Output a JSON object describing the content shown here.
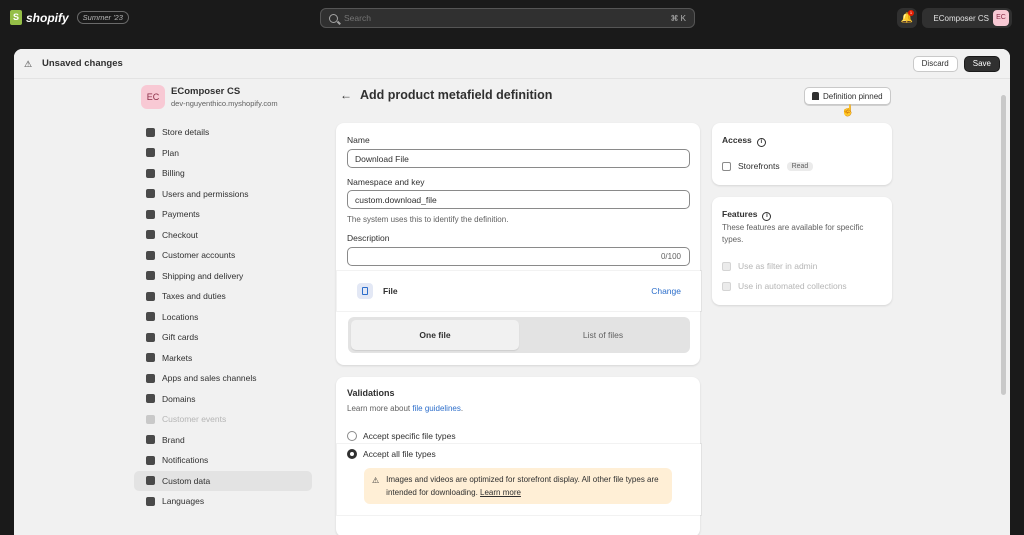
{
  "topbar": {
    "logo_text": "shopify",
    "edition": "Summer '23",
    "search_placeholder": "Search",
    "search_shortcut": "⌘ K",
    "store_name": "EComposer CS",
    "avatar_initials": "EC",
    "notification_count": "1"
  },
  "modal": {
    "title": "Unsaved changes",
    "discard_label": "Discard",
    "save_label": "Save"
  },
  "store": {
    "initials": "EC",
    "name": "EComposer CS",
    "domain": "dev-nguyenthico.myshopify.com"
  },
  "sidebar": {
    "items": [
      {
        "label": "Store details"
      },
      {
        "label": "Plan"
      },
      {
        "label": "Billing"
      },
      {
        "label": "Users and permissions"
      },
      {
        "label": "Payments"
      },
      {
        "label": "Checkout"
      },
      {
        "label": "Customer accounts"
      },
      {
        "label": "Shipping and delivery"
      },
      {
        "label": "Taxes and duties"
      },
      {
        "label": "Locations"
      },
      {
        "label": "Gift cards"
      },
      {
        "label": "Markets"
      },
      {
        "label": "Apps and sales channels"
      },
      {
        "label": "Domains"
      },
      {
        "label": "Customer events"
      },
      {
        "label": "Brand"
      },
      {
        "label": "Notifications"
      },
      {
        "label": "Custom data"
      },
      {
        "label": "Languages"
      }
    ],
    "active": "Custom data",
    "disabled": "Customer events"
  },
  "page": {
    "title": "Add product metafield definition",
    "pinned_label": "Definition pinned"
  },
  "form": {
    "name_label": "Name",
    "name_value": "Download File",
    "namespace_label": "Namespace and key",
    "namespace_value": "custom.download_file",
    "namespace_help": "The system uses this to identify the definition.",
    "description_label": "Description",
    "description_value": "",
    "description_counter": "0/100",
    "type_label": "File",
    "change_label": "Change",
    "seg_one": "One file",
    "seg_list": "List of files"
  },
  "validations": {
    "title": "Validations",
    "help_prefix": "Learn more about ",
    "help_link": "file guidelines",
    "help_suffix": ".",
    "option_specific": "Accept specific file types",
    "option_all": "Accept all file types",
    "banner_text": "Images and videos are optimized for storefront display. All other file types are intended for downloading.",
    "banner_link": "Learn more"
  },
  "access": {
    "title": "Access",
    "storefronts_label": "Storefronts",
    "read_badge": "Read"
  },
  "features": {
    "title": "Features",
    "description": "These features are available for specific types.",
    "filter_label": "Use as filter in admin",
    "collections_label": "Use in automated collections"
  },
  "colors": {
    "accent_link": "#2c6ecb",
    "banner_bg": "#ffefd6",
    "primary_button": "#303030"
  }
}
